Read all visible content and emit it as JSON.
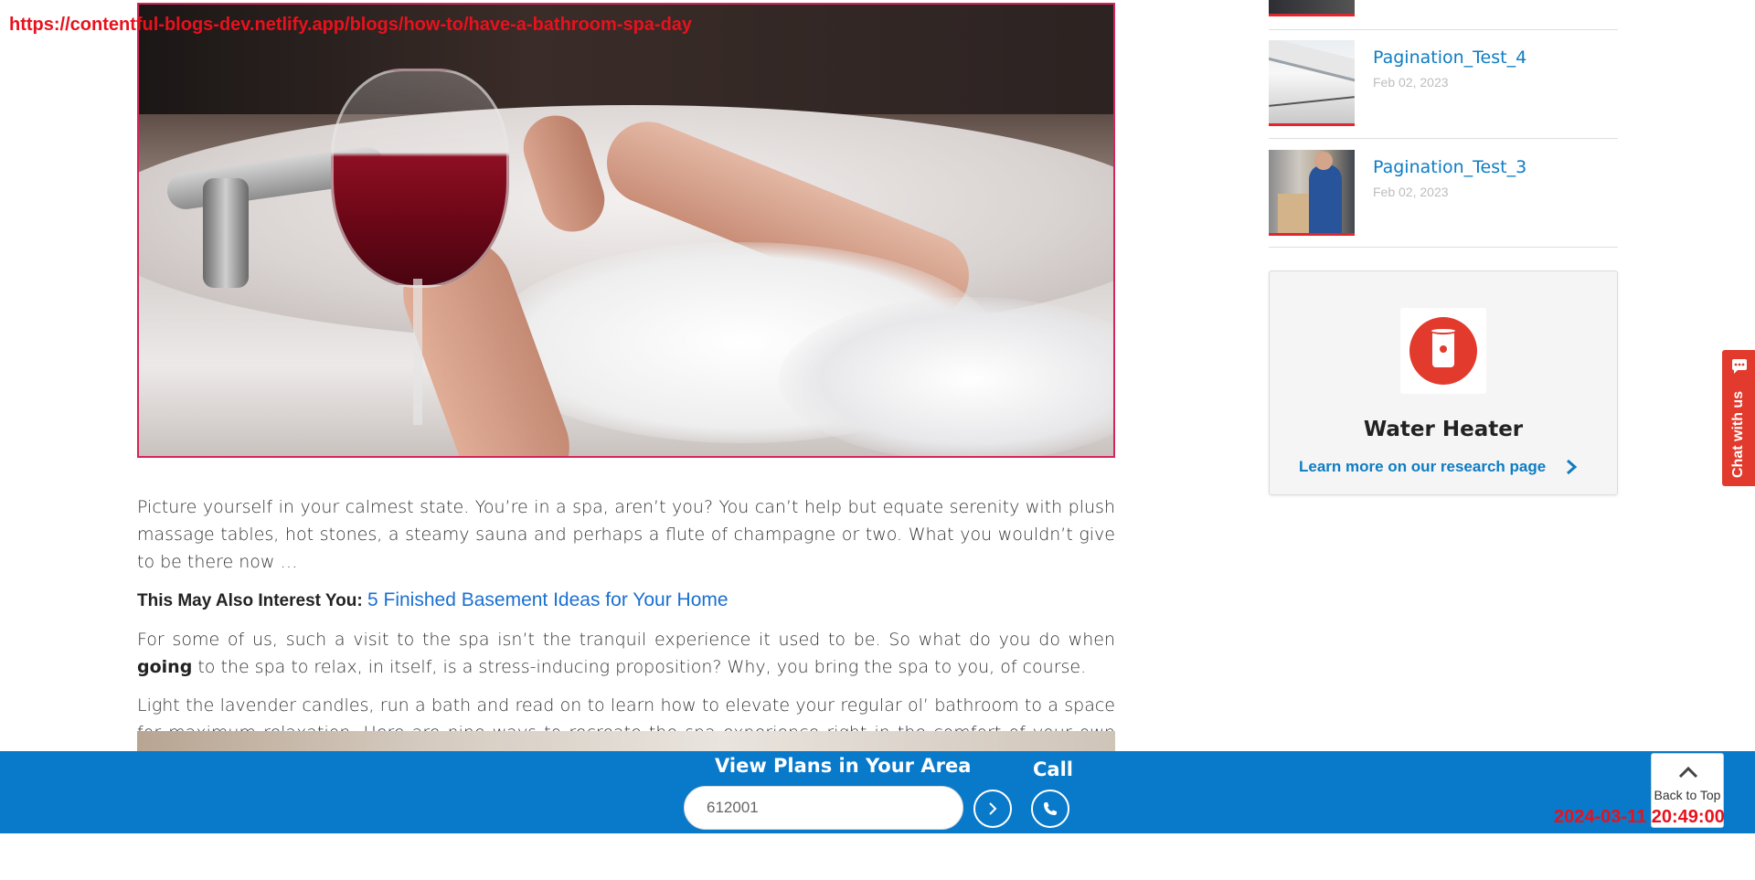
{
  "overlay": {
    "url": "https://contentful-blogs-dev.netlify.app/blogs/how-to/have-a-bathroom-spa-day",
    "timestamp": "2024-03-11 20:49:00"
  },
  "article": {
    "hero_image_icon": "bathtub-wine-photo",
    "paragraph_1": "Picture yourself in your calmest state. You’re in a spa, aren’t you? You can’t help but equate serenity with plush massage tables, hot stones, a steamy sauna and perhaps a flute of champagne or two. What you wouldn’t give to be there now …",
    "interest_label": "This May Also Interest You:",
    "interest_link": "5 Finished Basement Ideas for Your Home",
    "paragraph_2_before": "For some of us, such a visit to the spa isn’t the tranquil experience it used to be. So what do you do when ",
    "paragraph_2_bold": "going",
    "paragraph_2_after": " to the spa to relax, in itself, is a stress-inducing proposition? Why, you bring the spa to you, of course.",
    "paragraph_3": "Light the lavender candles, run a bath and read on to learn how to elevate your regular ol’ bathroom to a space for maximum relaxation. Here are nine ways to recreate the spa experience right in the comfort of your own home:"
  },
  "sidebar": {
    "posts": [
      {
        "title": "Pagination_Test_4",
        "date": "Feb 02, 2023"
      },
      {
        "title": "Pagination_Test_3",
        "date": "Feb 02, 2023"
      }
    ],
    "research_card": {
      "icon": "water-heater-icon",
      "title": "Water Heater",
      "link": "Learn more on our research page"
    }
  },
  "chat": {
    "label": "Chat with us"
  },
  "bottom_bar": {
    "plans_label": "View Plans in Your Area",
    "zip_value": "612001",
    "call_label": "Call",
    "back_to_top": "Back to Top"
  },
  "colors": {
    "brand_blue": "#0979ca",
    "link_blue": "#0e7cc3",
    "accent_red": "#e23b2e"
  }
}
